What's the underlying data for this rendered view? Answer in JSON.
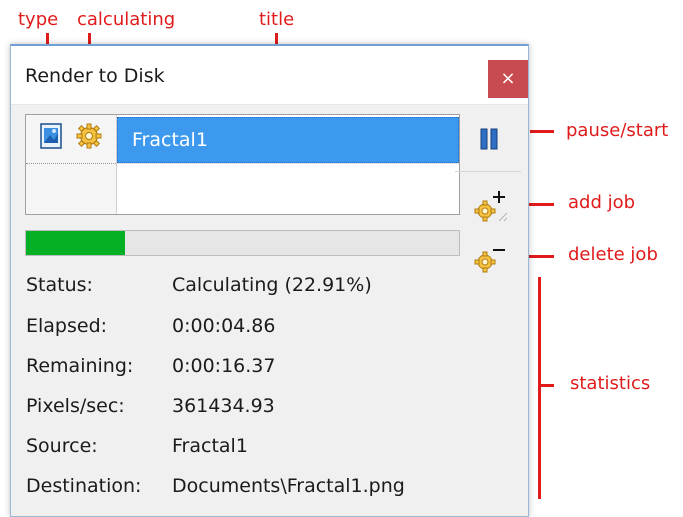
{
  "annotations": {
    "type": "type",
    "calculating": "calculating",
    "title": "title",
    "pause_start": "pause/start",
    "add_job": "add job",
    "delete_job": "delete job",
    "statistics": "statistics"
  },
  "window": {
    "title": "Render to Disk",
    "close_glyph": "×"
  },
  "jobs": [
    {
      "title": "Fractal1",
      "type_icon": "image-file-icon",
      "state_icon": "gear-icon"
    }
  ],
  "progress": {
    "value": 0.2291
  },
  "stats": [
    {
      "label": "Status:",
      "value": "Calculating (22.91%)"
    },
    {
      "label": "Elapsed:",
      "value": "0:00:04.86"
    },
    {
      "label": "Remaining:",
      "value": "0:00:16.37"
    },
    {
      "label": "Pixels/sec:",
      "value": "361434.93"
    },
    {
      "label": "Source:",
      "value": "Fractal1"
    },
    {
      "label": "Destination:",
      "value": "Documents\\Fractal1.png"
    }
  ],
  "buttons": {
    "pause_icon": "pause-icon",
    "add_icon": "gear-plus-icon",
    "delete_icon": "gear-minus-icon"
  },
  "colors": {
    "accent": "#3d99ee",
    "progress": "#06b025",
    "close": "#c74b50",
    "annotation": "#e01b1b"
  }
}
